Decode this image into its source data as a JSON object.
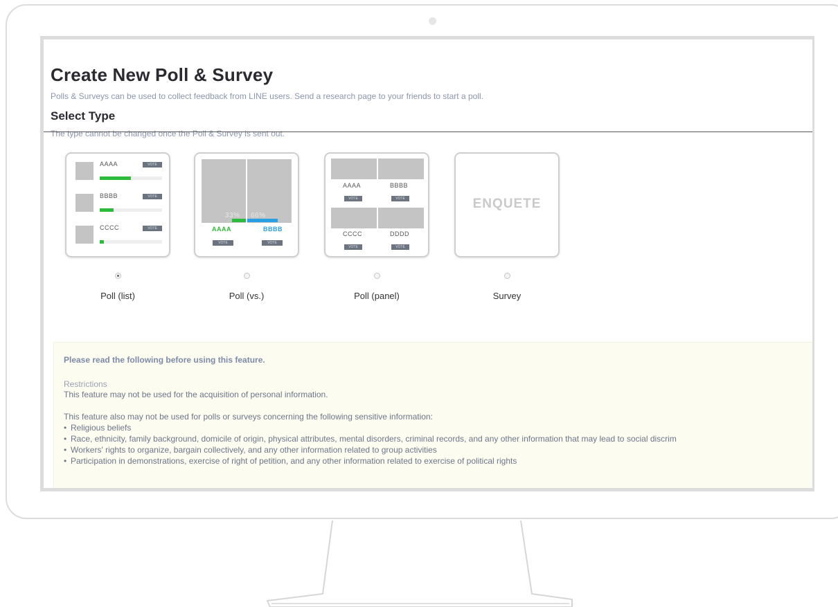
{
  "page": {
    "title": "Create New Poll & Survey",
    "description": "Polls & Surveys can be used to collect feedback from LINE users. Send a research page to your friends to start a poll.",
    "select_type_title": "Select Type",
    "select_type_desc": "The type cannot be changed once the Poll & Survey is sent out."
  },
  "types": [
    {
      "label": "Poll (list)",
      "selected": true
    },
    {
      "label": "Poll (vs.)",
      "selected": false
    },
    {
      "label": "Poll (panel)",
      "selected": false
    },
    {
      "label": "Survey",
      "selected": false
    }
  ],
  "previews": {
    "list": {
      "items": [
        "AAAA",
        "BBBB",
        "CCCC"
      ],
      "vote": "VOTE"
    },
    "vs": {
      "pct_a": "33%",
      "pct_b": "66%",
      "a": "AAAA",
      "b": "BBBB",
      "vote": "VOTE"
    },
    "panel": {
      "items": [
        "AAAA",
        "BBBB",
        "CCCC",
        "DDDD"
      ],
      "vote": "VOTE"
    },
    "survey": {
      "text": "ENQUETE"
    }
  },
  "notice": {
    "heading": "Please read the following before using this feature.",
    "restrictions_title": "Restrictions",
    "restrictions_text": "This feature may not be used for the acquisition of personal information.",
    "sensitive_intro": "This feature also may not be used for polls or surveys concerning the following sensitive information:",
    "bullets": [
      "Religious beliefs",
      "Race, ethnicity, family background, domicile of origin, physical attributes, mental disorders, criminal records, and any other information that may lead to social discrim",
      "Workers' rights to organize, bargain collectively, and any other information related to group activities",
      "Participation in demonstrations, exercise of right of petition, and any other information related to exercise of political rights"
    ]
  },
  "colors": {
    "accent_green": "#2dbb3c",
    "accent_blue": "#2aa0e4",
    "notice_bg": "#fcfcf0"
  }
}
